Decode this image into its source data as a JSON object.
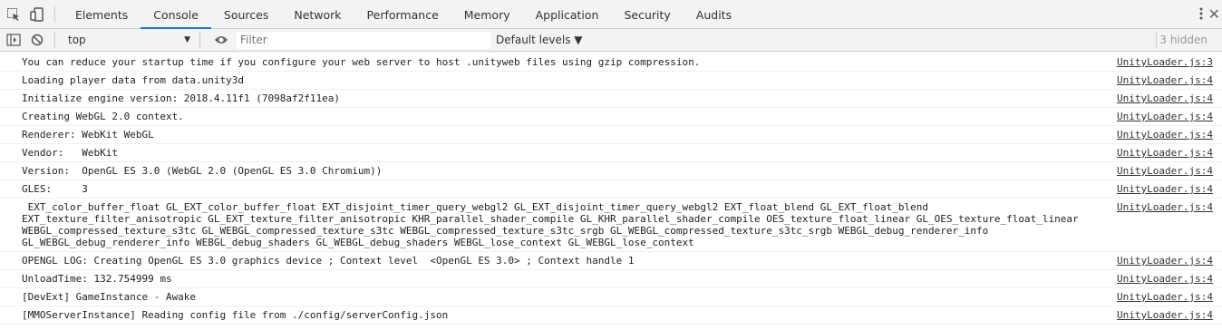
{
  "tabs": [
    "Elements",
    "Console",
    "Sources",
    "Network",
    "Performance",
    "Memory",
    "Application",
    "Security",
    "Audits"
  ],
  "toolbar": {
    "context": "top",
    "filter_placeholder": "Filter",
    "levels_label": "Default levels ▼",
    "hidden_count": "3 hidden"
  },
  "messages": [
    {
      "text": "You can reduce your startup time if you configure your web server to host .unityweb files using gzip compression.",
      "source": "UnityLoader.js:3"
    },
    {
      "text": "Loading player data from data.unity3d",
      "source": "UnityLoader.js:4"
    },
    {
      "text": "Initialize engine version: 2018.4.11f1 (7098af2f11ea)",
      "source": "UnityLoader.js:4"
    },
    {
      "text": "Creating WebGL 2.0 context.",
      "source": "UnityLoader.js:4"
    },
    {
      "text": "Renderer: WebKit WebGL",
      "source": "UnityLoader.js:4"
    },
    {
      "text": "Vendor:   WebKit",
      "source": "UnityLoader.js:4"
    },
    {
      "text": "Version:  OpenGL ES 3.0 (WebGL 2.0 (OpenGL ES 3.0 Chromium))",
      "source": "UnityLoader.js:4"
    },
    {
      "text": "GLES:     3",
      "source": "UnityLoader.js:4"
    },
    {
      "text": " EXT_color_buffer_float GL_EXT_color_buffer_float EXT_disjoint_timer_query_webgl2 GL_EXT_disjoint_timer_query_webgl2 EXT_float_blend GL_EXT_float_blend EXT_texture_filter_anisotropic GL_EXT_texture_filter_anisotropic KHR_parallel_shader_compile GL_KHR_parallel_shader_compile OES_texture_float_linear GL_OES_texture_float_linear WEBGL_compressed_texture_s3tc GL_WEBGL_compressed_texture_s3tc WEBGL_compressed_texture_s3tc_srgb GL_WEBGL_compressed_texture_s3tc_srgb WEBGL_debug_renderer_info GL_WEBGL_debug_renderer_info WEBGL_debug_shaders GL_WEBGL_debug_shaders WEBGL_lose_context GL_WEBGL_lose_context",
      "source": "UnityLoader.js:4"
    },
    {
      "text": "OPENGL LOG: Creating OpenGL ES 3.0 graphics device ; Context level  <OpenGL ES 3.0> ; Context handle 1",
      "source": "UnityLoader.js:4"
    },
    {
      "text": "UnloadTime: 132.754999 ms",
      "source": "UnityLoader.js:4"
    },
    {
      "text": "[DevExt] GameInstance - Awake",
      "source": "UnityLoader.js:4"
    },
    {
      "text": "[MMOServerInstance] Reading config file from ./config/serverConfig.json",
      "source": "UnityLoader.js:4"
    }
  ]
}
